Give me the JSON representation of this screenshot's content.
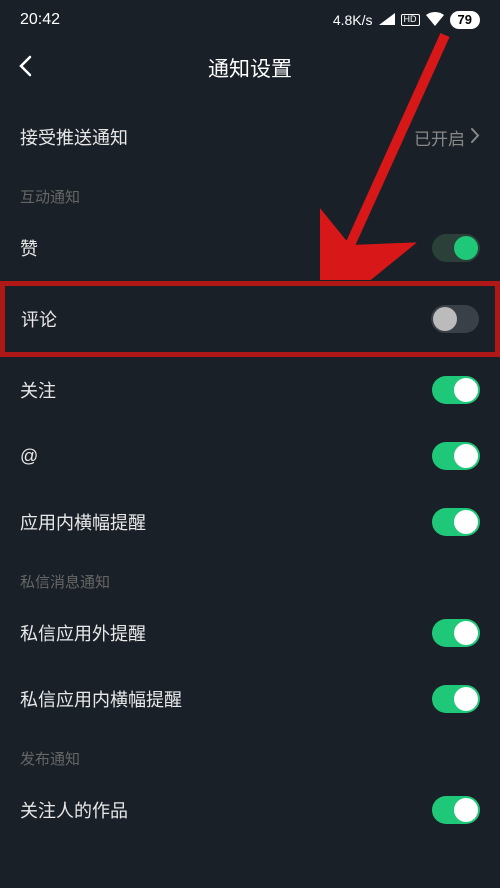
{
  "status": {
    "time": "20:42",
    "speed": "4.8K/s",
    "hd": "HD",
    "battery": "79"
  },
  "header": {
    "title": "通知设置"
  },
  "push": {
    "label": "接受推送通知",
    "value": "已开启"
  },
  "sections": [
    {
      "title": "互动通知",
      "items": [
        {
          "label": "赞",
          "on": true
        },
        {
          "label": "评论",
          "on": false,
          "highlighted": true
        },
        {
          "label": "关注",
          "on": true
        },
        {
          "label": "@",
          "on": true
        },
        {
          "label": "应用内横幅提醒",
          "on": true
        }
      ]
    },
    {
      "title": "私信消息通知",
      "items": [
        {
          "label": "私信应用外提醒",
          "on": true
        },
        {
          "label": "私信应用内横幅提醒",
          "on": true
        }
      ]
    },
    {
      "title": "发布通知",
      "items": [
        {
          "label": "关注人的作品",
          "on": true
        }
      ]
    }
  ]
}
